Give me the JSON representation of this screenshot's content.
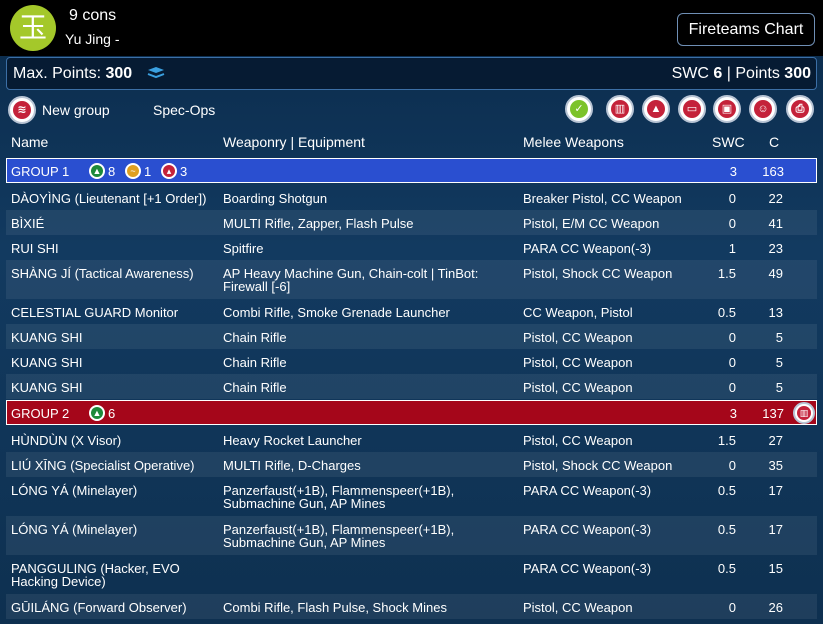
{
  "header": {
    "logo_glyph": "玉",
    "army_title": "9 cons",
    "army_subtitle": "Yu Jing -",
    "fireteams_label": "Fireteams Chart"
  },
  "points_bar": {
    "max_label": "Max. Points:",
    "max_value": "300",
    "swc_label": "SWC",
    "swc_value": "6",
    "separator": "|",
    "points_label": "Points",
    "points_value": "300"
  },
  "toolbar": {
    "new_group_label": "New group",
    "spec_ops_label": "Spec-Ops",
    "icons": [
      "check-icon",
      "trash-icon",
      "warning-icon",
      "chat-icon",
      "save-icon",
      "face-icon",
      "print-icon"
    ]
  },
  "columns": {
    "name": "Name",
    "weapons": "Weaponry | Equipment",
    "melee": "Melee Weapons",
    "swc": "SWC",
    "c": "C"
  },
  "groups": [
    {
      "label": "GROUP 1",
      "badges": [
        {
          "icon": "regular-order-icon",
          "count": "8"
        },
        {
          "icon": "irregular-order-icon",
          "count": "1"
        },
        {
          "icon": "impetuous-order-icon",
          "count": "3"
        }
      ],
      "swc": "3",
      "c": "163",
      "color": "#2a4fd0"
    },
    {
      "label": "GROUP 2",
      "badges": [
        {
          "icon": "regular-order-icon",
          "count": "6"
        }
      ],
      "swc": "3",
      "c": "137",
      "color": "#a5061a"
    }
  ],
  "rows": [
    {
      "name": "DÀOYÌNG (Lieutenant [+1 Order])",
      "weapons": "Boarding Shotgun",
      "melee": "Breaker Pistol, CC Weapon",
      "swc": "0",
      "c": "22"
    },
    {
      "name": "BÌXIÉ",
      "weapons": "MULTI Rifle, Zapper, Flash Pulse",
      "melee": "Pistol, E/M CC Weapon",
      "swc": "0",
      "c": "41"
    },
    {
      "name": "RUI SHI",
      "weapons": "Spitfire",
      "melee": "PARA CC Weapon(-3)",
      "swc": "1",
      "c": "23"
    },
    {
      "name": "SHÀNG JÍ (Tactical Awareness)",
      "weapons": "AP Heavy Machine Gun, Chain-colt | TinBot: Firewall [-6]",
      "melee": "Pistol, Shock CC Weapon",
      "swc": "1.5",
      "c": "49"
    },
    {
      "name": "CELESTIAL GUARD Monitor",
      "weapons": "Combi Rifle, Smoke Grenade Launcher",
      "melee": "CC Weapon, Pistol",
      "swc": "0.5",
      "c": "13"
    },
    {
      "name": "KUANG SHI",
      "weapons": "Chain Rifle",
      "melee": "Pistol, CC Weapon",
      "swc": "0",
      "c": "5"
    },
    {
      "name": "KUANG SHI",
      "weapons": "Chain Rifle",
      "melee": "Pistol, CC Weapon",
      "swc": "0",
      "c": "5"
    },
    {
      "name": "KUANG SHI",
      "weapons": "Chain Rifle",
      "melee": "Pistol, CC Weapon",
      "swc": "0",
      "c": "5"
    },
    {
      "name": "HÙNDÙN (X Visor)",
      "weapons": "Heavy Rocket Launcher",
      "melee": "Pistol, CC Weapon",
      "swc": "1.5",
      "c": "27"
    },
    {
      "name": "LIÚ XĪNG (Specialist Operative)",
      "weapons": "MULTI Rifle, D-Charges",
      "melee": "Pistol, Shock CC Weapon",
      "swc": "0",
      "c": "35"
    },
    {
      "name": "LÓNG YÁ (Minelayer)",
      "weapons": "Panzerfaust(+1B), Flammenspeer(+1B), Submachine Gun, AP Mines",
      "melee": "PARA CC Weapon(-3)",
      "swc": "0.5",
      "c": "17"
    },
    {
      "name": "LÓNG YÁ (Minelayer)",
      "weapons": "Panzerfaust(+1B), Flammenspeer(+1B), Submachine Gun, AP Mines",
      "melee": "PARA CC Weapon(-3)",
      "swc": "0.5",
      "c": "17"
    },
    {
      "name": "PANGGULING (Hacker, EVO Hacking Device)",
      "weapons": "",
      "melee": "PARA CC Weapon(-3)",
      "swc": "0.5",
      "c": "15"
    },
    {
      "name": "GŪILÁNG (Forward Observer)",
      "weapons": "Combi Rifle, Flash Pulse, Shock Mines",
      "melee": "Pistol, CC Weapon",
      "swc": "0",
      "c": "26"
    }
  ]
}
